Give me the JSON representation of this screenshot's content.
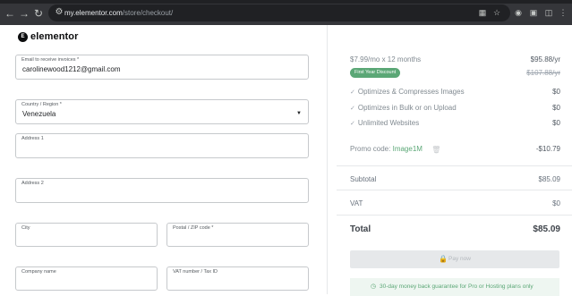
{
  "browser": {
    "url_domain": "my.elementor.com",
    "url_path": "/store/checkout/",
    "icons": [
      "back-icon",
      "forward-icon",
      "reload-icon",
      "site-settings-icon",
      "translate-icon",
      "bookmark-star-icon",
      "profile-icon",
      "extensions-icon",
      "menu-icon"
    ]
  },
  "header": {
    "logo_mark": "E",
    "logo_text": "elementor"
  },
  "form": {
    "email": {
      "label": "Email to receive invoices *",
      "value": "carolinewood1212@gmail.com"
    },
    "country": {
      "label": "Country / Region *",
      "value": "Venezuela"
    },
    "address1": {
      "label": "Address 1",
      "value": ""
    },
    "address2": {
      "label": "Address 2",
      "value": ""
    },
    "city": {
      "label": "City",
      "value": ""
    },
    "postal": {
      "label": "Postal / ZIP code *",
      "value": ""
    },
    "company": {
      "label": "Company name",
      "value": ""
    },
    "vat_number": {
      "label": "VAT number / Tax ID",
      "value": ""
    }
  },
  "summary": {
    "plan_label": "$7.99/mo x 12 months",
    "plan_price": "$95.88/yr",
    "discount_badge": "First Year Discount",
    "original_price": "$107.88/yr",
    "features": [
      {
        "label": "Optimizes & Compresses Images",
        "price": "$0"
      },
      {
        "label": "Optimizes in Bulk or on Upload",
        "price": "$0"
      },
      {
        "label": "Unlimited Websites",
        "price": "$0"
      }
    ],
    "check_glyph": "✓",
    "promo_label": "Promo code:",
    "promo_code": "Image1M",
    "promo_amount": "-$10.79",
    "subtotal_label": "Subtotal",
    "subtotal_value": "$85.09",
    "vat_label": "VAT",
    "vat_value": "$0",
    "total_label": "Total",
    "total_value": "$85.09",
    "pay_button": "Pay now",
    "guarantee": "30-day money back guarantee for Pro or Hosting plans only"
  },
  "colors": {
    "accent_green": "#5ba776",
    "text_dark": "#1f2124",
    "muted": "#818a91",
    "chrome_bg": "#35363a"
  }
}
